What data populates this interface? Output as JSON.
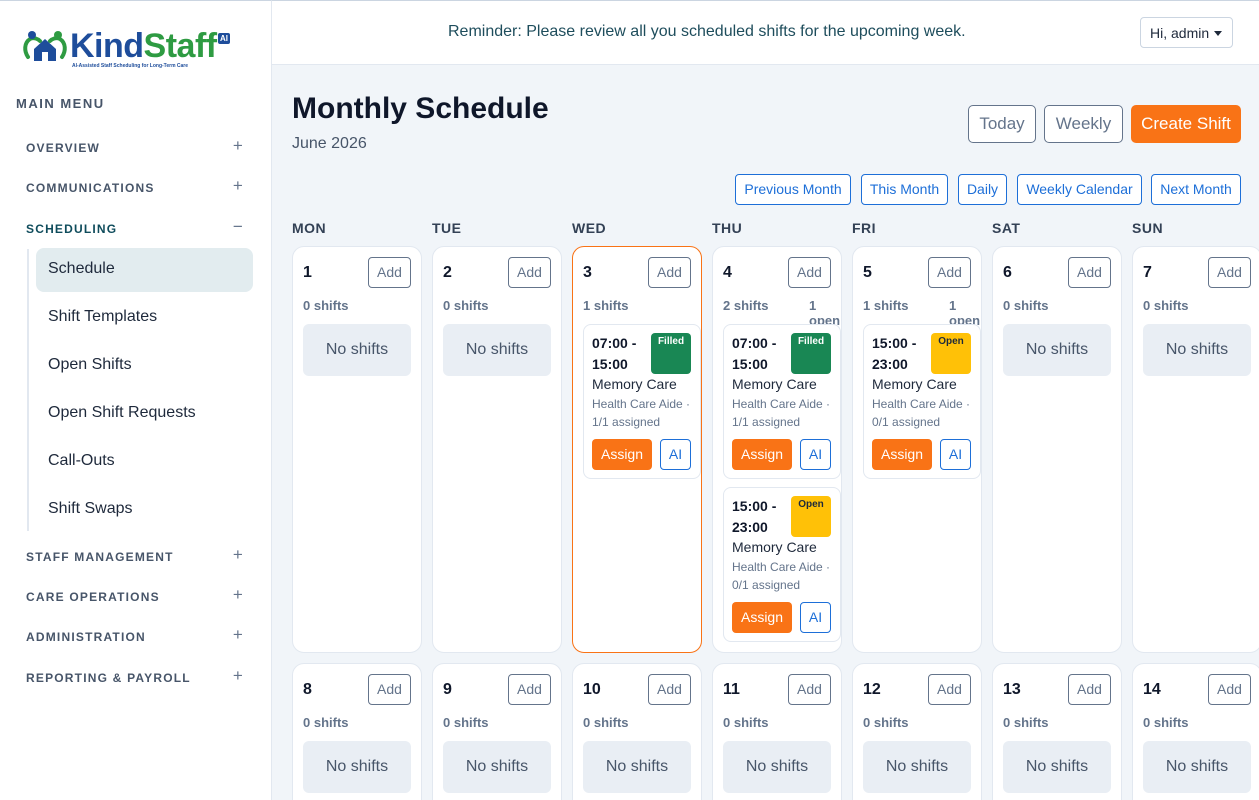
{
  "brand": {
    "name_part1": "Kind",
    "name_part2": "Staff",
    "badge": "AI",
    "tagline": "AI-Assisted Staff Scheduling for Long-Term Care",
    "color_primary": "#1e4d9b",
    "color_secondary": "#2e9b42"
  },
  "sidebar": {
    "main_menu": "MAIN MENU",
    "sections": [
      {
        "label": "OVERVIEW",
        "toggle": "+"
      },
      {
        "label": "COMMUNICATIONS",
        "toggle": "+"
      },
      {
        "label": "SCHEDULING",
        "toggle": "−"
      },
      {
        "label": "STAFF MANAGEMENT",
        "toggle": "+"
      },
      {
        "label": "CARE OPERATIONS",
        "toggle": "+"
      },
      {
        "label": "ADMINISTRATION",
        "toggle": "+"
      },
      {
        "label": "REPORTING & PAYROLL",
        "toggle": "+"
      }
    ],
    "scheduling_items": [
      "Schedule",
      "Shift Templates",
      "Open Shifts",
      "Open Shift Requests",
      "Call-Outs",
      "Shift Swaps"
    ]
  },
  "topbar": {
    "reminder": "Reminder: Please review all you scheduled shifts for the upcoming week.",
    "user": "Hi, admin"
  },
  "header": {
    "title": "Monthly Schedule",
    "subtitle": "June 2026",
    "today": "Today",
    "weekly": "Weekly",
    "create": "Create Shift"
  },
  "nav": {
    "prev": "Previous Month",
    "this": "This Month",
    "daily": "Daily",
    "weekly_cal": "Weekly Calendar",
    "next": "Next Month"
  },
  "weekdays": [
    "MON",
    "TUE",
    "WED",
    "THU",
    "FRI",
    "SAT",
    "SUN"
  ],
  "calendar": {
    "add_label": "Add",
    "no_shifts": "No shifts",
    "assign_label": "Assign",
    "ai_label": "AI",
    "days": [
      {
        "num": "1",
        "count": "0 shifts"
      },
      {
        "num": "2",
        "count": "0 shifts"
      },
      {
        "num": "3",
        "count": "1 shifts",
        "today": true,
        "shifts": [
          {
            "time": "07:00 - 15:00",
            "status": "Filled",
            "unit": "Memory Care",
            "role": "Health Care Aide ·",
            "assigned": "1/1 assigned"
          }
        ]
      },
      {
        "num": "4",
        "count": "2 shifts",
        "open": "1 open",
        "shifts": [
          {
            "time": "07:00 - 15:00",
            "status": "Filled",
            "unit": "Memory Care",
            "role": "Health Care Aide ·",
            "assigned": "1/1 assigned"
          },
          {
            "time": "15:00 - 23:00",
            "status": "Open",
            "unit": "Memory Care",
            "role": "Health Care Aide ·",
            "assigned": "0/1 assigned"
          }
        ]
      },
      {
        "num": "5",
        "count": "1 shifts",
        "open": "1 open",
        "shifts": [
          {
            "time": "15:00 - 23:00",
            "status": "Open",
            "unit": "Memory Care",
            "role": "Health Care Aide ·",
            "assigned": "0/1 assigned"
          }
        ]
      },
      {
        "num": "6",
        "count": "0 shifts"
      },
      {
        "num": "7",
        "count": "0 shifts"
      },
      {
        "num": "8",
        "count": "0 shifts"
      },
      {
        "num": "9",
        "count": "0 shifts"
      },
      {
        "num": "10",
        "count": "0 shifts"
      },
      {
        "num": "11",
        "count": "0 shifts"
      },
      {
        "num": "12",
        "count": "0 shifts"
      },
      {
        "num": "13",
        "count": "0 shifts"
      },
      {
        "num": "14",
        "count": "0 shifts"
      }
    ]
  }
}
